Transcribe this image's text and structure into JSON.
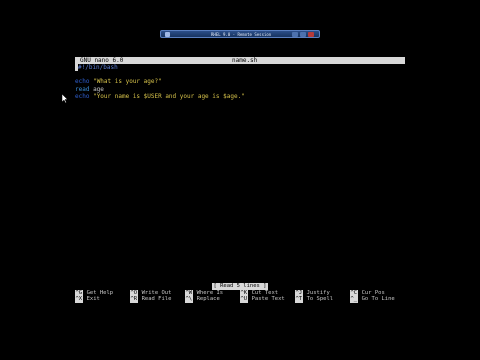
{
  "window": {
    "title": "RHEL 9.0 - Remote Session"
  },
  "nano": {
    "version": "GNU nano 6.0",
    "filename": "name.sh",
    "status": "[ Read 5 lines ]"
  },
  "editor": {
    "lines": {
      "shebang": "#!/bin/bash",
      "echo1_cmd": "echo",
      "echo1_str": "\"What is your age?\"",
      "read_cmd": "read",
      "read_arg": " age",
      "echo2_cmd": "echo",
      "echo2_str": "\"Your name is $USER and your age is $age.\""
    }
  },
  "shortcuts": [
    {
      "key": "^G",
      "label": "Get Help"
    },
    {
      "key": "^O",
      "label": "Write Out"
    },
    {
      "key": "^W",
      "label": "Where Is"
    },
    {
      "key": "^K",
      "label": "Cut Text"
    },
    {
      "key": "^J",
      "label": "Justify"
    },
    {
      "key": "^C",
      "label": "Cur Pos"
    },
    {
      "key": "^X",
      "label": "Exit"
    },
    {
      "key": "^R",
      "label": "Read File"
    },
    {
      "key": "^\\",
      "label": "Replace"
    },
    {
      "key": "^U",
      "label": "Paste Text"
    },
    {
      "key": "^T",
      "label": "To Spell"
    },
    {
      "key": "^_",
      "label": "Go To Line"
    }
  ],
  "colors": {
    "background": "#000000",
    "header_bg": "#d8d8d8",
    "string": "#d6c24a",
    "keyword": "#2f5fd0"
  },
  "icons": {
    "pointer": "mouse-pointer-icon"
  }
}
